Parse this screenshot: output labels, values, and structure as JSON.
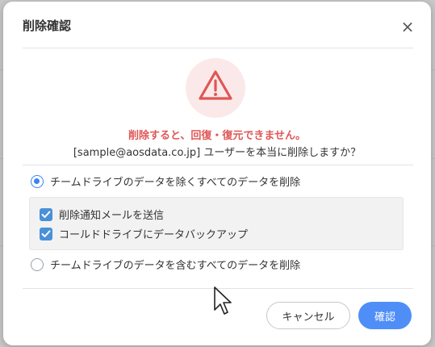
{
  "dialog": {
    "title": "削除確認",
    "close_symbol": "×",
    "warning_icon": "warning-triangle-icon",
    "warning_text": "削除すると、回復・復元できません。",
    "confirm_text": "[sample@aosdata.co.jp] ユーザーを本当に削除しますか？",
    "options": [
      {
        "label": "チームドライブのデータを除くすべてのデータを削除",
        "selected": true
      },
      {
        "label": "チームドライブのデータを含むすべてのデータを削除",
        "selected": false
      }
    ],
    "checkboxes": [
      {
        "label": "削除通知メールを送信",
        "checked": true
      },
      {
        "label": "コールドドライブにデータバックアップ",
        "checked": true
      }
    ],
    "cancel_label": "キャンセル",
    "confirm_label": "確認"
  },
  "colors": {
    "accent": "#4f8ef7",
    "warning": "#e05656",
    "warning_bg": "#fbe9e9"
  }
}
